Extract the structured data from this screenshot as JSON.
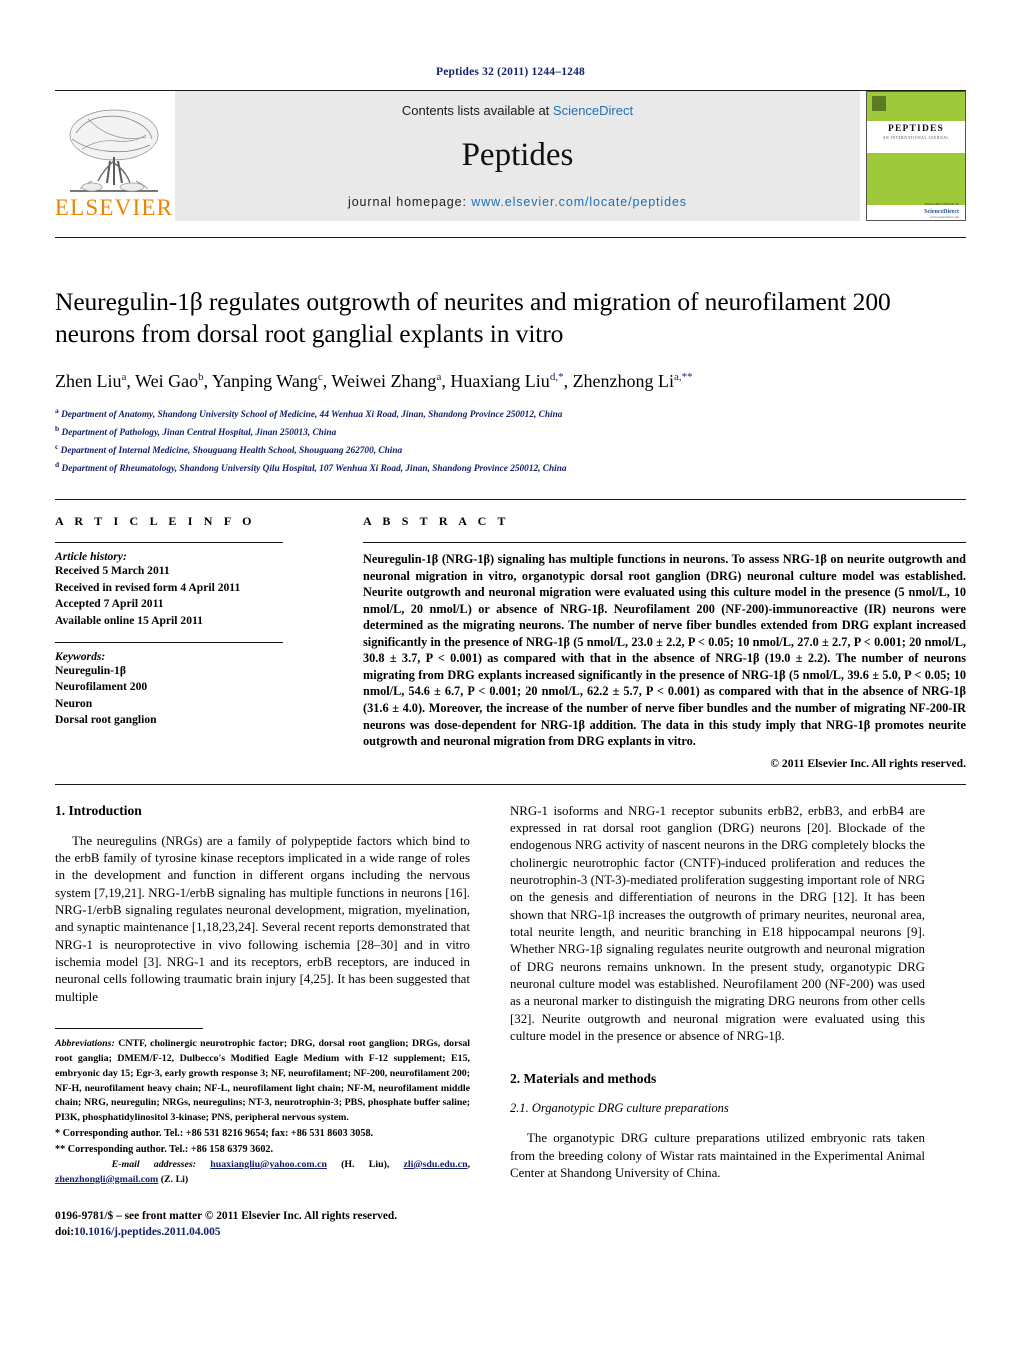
{
  "running_head": "Peptides 32 (2011) 1244–1248",
  "masthead": {
    "contents_prefix": "Contents lists available at ",
    "sciencedirect": "ScienceDirect",
    "journal_title": "Peptides",
    "homepage_prefix": "journal homepage: ",
    "homepage_url": "www.elsevier.com/locate/peptides",
    "publisher_logo_text": "ELSEVIER",
    "cover": {
      "name": "PEPTIDES",
      "subtitle": "AN INTERNATIONAL JOURNAL",
      "footer_top": "AVAILABLE ONLINE AT",
      "footer_mid": "ScienceDirect",
      "footer_bottom": "www.sciencedirect.com"
    },
    "accent_color": "#1f6fb5",
    "logo_color": "#ef8200",
    "cover_green": "#9ec93b"
  },
  "article": {
    "title": "Neuregulin-1β regulates outgrowth of neurites and migration of neurofilament 200 neurons from dorsal root ganglial explants in vitro",
    "authors": [
      {
        "name": "Zhen Liu",
        "marks": "a"
      },
      {
        "name": "Wei Gao",
        "marks": "b"
      },
      {
        "name": "Yanping Wang",
        "marks": "c"
      },
      {
        "name": "Weiwei Zhang",
        "marks": "a"
      },
      {
        "name": "Huaxiang Liu",
        "marks": "d,*"
      },
      {
        "name": "Zhenzhong Li",
        "marks": "a,**"
      }
    ],
    "affiliations": [
      {
        "mark": "a",
        "text": "Department of Anatomy, Shandong University School of Medicine, 44 Wenhua Xi Road, Jinan, Shandong Province 250012, China"
      },
      {
        "mark": "b",
        "text": "Department of Pathology, Jinan Central Hospital, Jinan 250013, China"
      },
      {
        "mark": "c",
        "text": "Department of Internal Medicine, Shouguang Health School, Shouguang 262700, China"
      },
      {
        "mark": "d",
        "text": "Department of Rheumatology, Shandong University Qilu Hospital, 107 Wenhua Xi Road, Jinan, Shandong Province 250012, China"
      }
    ]
  },
  "article_info": {
    "heading": "A R T I C L E    I N F O",
    "history_label": "Article history:",
    "history": [
      "Received 5 March 2011",
      "Received in revised form 4 April 2011",
      "Accepted 7 April 2011",
      "Available online 15 April 2011"
    ],
    "keywords_label": "Keywords:",
    "keywords": [
      "Neuregulin-1β",
      "Neurofilament 200",
      "Neuron",
      "Dorsal root ganglion"
    ]
  },
  "abstract": {
    "heading": "A B S T R A C T",
    "text": "Neuregulin-1β (NRG-1β) signaling has multiple functions in neurons. To assess NRG-1β on neurite outgrowth and neuronal migration in vitro, organotypic dorsal root ganglion (DRG) neuronal culture model was established. Neurite outgrowth and neuronal migration were evaluated using this culture model in the presence (5 nmol/L, 10 nmol/L, 20 nmol/L) or absence of NRG-1β. Neurofilament 200 (NF-200)-immunoreactive (IR) neurons were determined as the migrating neurons. The number of nerve fiber bundles extended from DRG explant increased significantly in the presence of NRG-1β (5 nmol/L, 23.0 ± 2.2, P < 0.05; 10 nmol/L, 27.0 ± 2.7, P < 0.001; 20 nmol/L, 30.8 ± 3.7, P < 0.001) as compared with that in the absence of NRG-1β (19.0 ± 2.2). The number of neurons migrating from DRG explants increased significantly in the presence of NRG-1β (5 nmol/L, 39.6 ± 5.0, P < 0.05; 10 nmol/L, 54.6 ± 6.7, P < 0.001; 20 nmol/L, 62.2 ± 5.7, P < 0.001) as compared with that in the absence of NRG-1β (31.6 ± 4.0). Moreover, the increase of the number of nerve fiber bundles and the number of migrating NF-200-IR neurons was dose-dependent for NRG-1β addition. The data in this study imply that NRG-1β promotes neurite outgrowth and neuronal migration from DRG explants in vitro.",
    "copyright": "© 2011 Elsevier Inc. All rights reserved."
  },
  "sections": {
    "introduction_heading": "1.  Introduction",
    "intro_para_left": "The neuregulins (NRGs) are a family of polypeptide factors which bind to the erbB family of tyrosine kinase receptors implicated in a wide range of roles in the development and function in different organs including the nervous system [7,19,21]. NRG-1/erbB signaling has multiple functions in neurons [16]. NRG-1/erbB signaling regulates neuronal development, migration, myelination, and synaptic maintenance [1,18,23,24]. Several recent reports demonstrated that NRG-1 is neuroprotective in vivo following ischemia [28–30] and in vitro ischemia model [3]. NRG-1 and its receptors, erbB receptors, are induced in neuronal cells following traumatic brain injury [4,25]. It has been suggested that multiple",
    "intro_para_right": "NRG-1 isoforms and NRG-1 receptor subunits erbB2, erbB3, and erbB4 are expressed in rat dorsal root ganglion (DRG) neurons [20]. Blockade of the endogenous NRG activity of nascent neurons in the DRG completely blocks the cholinergic neurotrophic factor (CNTF)-induced proliferation and reduces the neurotrophin-3 (NT-3)-mediated proliferation suggesting important role of NRG on the genesis and differentiation of neurons in the DRG [12]. It has been shown that NRG-1β increases the outgrowth of primary neurites, neuronal area, total neurite length, and neuritic branching in E18 hippocampal neurons [9]. Whether NRG-1β signaling regulates neurite outgrowth and neuronal migration of DRG neurons remains unknown. In the present study, organotypic DRG neuronal culture model was established. Neurofilament 200 (NF-200) was used as a neuronal marker to distinguish the migrating DRG neurons from other cells [32]. Neurite outgrowth and neuronal migration were evaluated using this culture model in the presence or absence of NRG-1β.",
    "methods_heading": "2.  Materials and methods",
    "methods_sub_heading": "2.1.  Organotypic DRG culture preparations",
    "methods_para": "The organotypic DRG culture preparations utilized embryonic rats taken from the breeding colony of Wistar rats maintained in the Experimental Animal Center at Shandong University of China."
  },
  "footnotes": {
    "abbreviations_label": "Abbreviations:",
    "abbreviations_text": "CNTF, cholinergic neurotrophic factor; DRG, dorsal root ganglion; DRGs, dorsal root ganglia; DMEM/F-12, Dulbecco's Modified Eagle Medium with F-12 supplement; E15, embryonic day 15; Egr-3, early growth response 3; NF, neurofilament; NF-200, neurofilament 200; NF-H, neurofilament heavy chain; NF-L, neurofilament light chain; NF-M, neurofilament middle chain; NRG, neuregulin; NRGs, neuregulins; NT-3, neurotrophin-3; PBS, phosphate buffer saline; PI3K, phosphatidylinositol 3-kinase; PNS, peripheral nervous system.",
    "corresponding_1": "*  Corresponding author. Tel.: +86 531 8216 9654; fax: +86 531 8603 3058.",
    "corresponding_2": "**  Corresponding author. Tel.: +86 158 6379 3602.",
    "email_label": "E-mail addresses:",
    "emails": [
      {
        "address": "huaxiangliu@yahoo.com.cn",
        "who": "(H. Liu)"
      },
      {
        "address": "zli@sdu.edu.cn",
        "who": ""
      },
      {
        "address": "zhenzhongli@gmail.com",
        "who": "(Z. Li)"
      }
    ]
  },
  "imprint": {
    "line1": "0196-9781/$ – see front matter © 2011 Elsevier Inc. All rights reserved.",
    "doi_label": "doi:",
    "doi": "10.1016/j.peptides.2011.04.005"
  }
}
